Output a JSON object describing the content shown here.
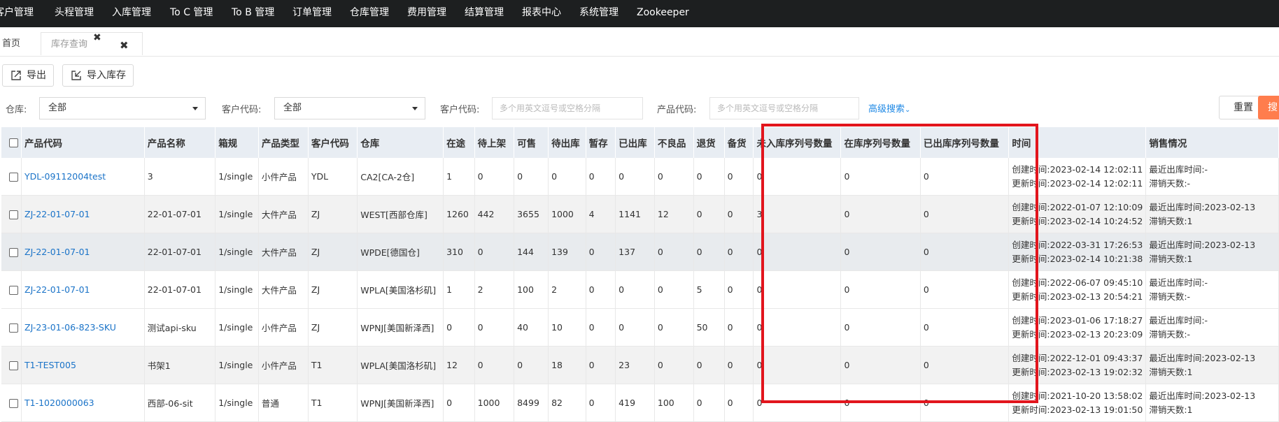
{
  "nav": [
    "客户管理",
    "头程管理",
    "入库管理",
    "To C 管理",
    "To B 管理",
    "订单管理",
    "仓库管理",
    "费用管理",
    "结算管理",
    "报表中心",
    "系统管理",
    "Zookeeper"
  ],
  "tabs": {
    "home": "首页",
    "stock": "库存查询"
  },
  "toolbar": {
    "export": "导出",
    "import": "导入库存"
  },
  "filters": {
    "warehouse_label": "仓库:",
    "warehouse_value": "全部",
    "customer_code_label": "客户代码:",
    "customer_code_value": "全部",
    "customer_code2_label": "客户代码:",
    "customer_code2_placeholder": "多个用英文逗号或空格分隔",
    "product_code_label": "产品代码:",
    "product_code_placeholder": "多个用英文逗号或空格分隔",
    "advanced": "高级搜索",
    "reset": "重置",
    "search": "搜"
  },
  "columns": [
    "产品代码",
    "产品名称",
    "箱规",
    "产品类型",
    "客户代码",
    "仓库",
    "在途",
    "待上架",
    "可售",
    "待出库",
    "暂存",
    "已出库",
    "不良品",
    "退货",
    "备货",
    "未入库序列号数量",
    "在库序列号数量",
    "已出库序列号数量",
    "时间",
    "销售情况"
  ],
  "time_labels": {
    "created": "创建时间:",
    "updated": "更新时间:"
  },
  "sales_labels": {
    "last_out": "最近出库时间:",
    "slow_days": "滞销天数:"
  },
  "rows": [
    {
      "code": "YDL-09112004test",
      "name": "3",
      "box": "1/single",
      "type": "小件产品",
      "cust": "YDL",
      "wh": "CA2[CA-2仓]",
      "c1": "1",
      "c2": "0",
      "c3": "0",
      "c4": "0",
      "c5": "0",
      "c6": "0",
      "c7": "0",
      "c8": "0",
      "c9": "0",
      "s1": "0",
      "s2": "0",
      "s3": "0",
      "created": "2023-02-14 12:02:11",
      "updated": "2023-02-14 12:02:11",
      "last_out": "-",
      "slow_days": "-"
    },
    {
      "code": "ZJ-22-01-07-01",
      "name": "22-01-07-01",
      "box": "1/single",
      "type": "大件产品",
      "cust": "ZJ",
      "wh": "WEST[西部仓库]",
      "c1": "1260",
      "c2": "442",
      "c3": "3655",
      "c4": "1000",
      "c5": "4",
      "c6": "1141",
      "c7": "12",
      "c8": "0",
      "c9": "0",
      "s1": "3",
      "s2": "0",
      "s3": "0",
      "created": "2022-01-07 12:10:09",
      "updated": "2023-02-14 10:24:52",
      "last_out": "2023-02-13",
      "slow_days": "1"
    },
    {
      "code": "ZJ-22-01-07-01",
      "name": "22-01-07-01",
      "box": "1/single",
      "type": "大件产品",
      "cust": "ZJ",
      "wh": "WPDE[德国仓]",
      "c1": "310",
      "c2": "0",
      "c3": "144",
      "c4": "139",
      "c5": "0",
      "c6": "137",
      "c7": "0",
      "c8": "0",
      "c9": "0",
      "s1": "0",
      "s2": "0",
      "s3": "0",
      "created": "2022-03-31 17:26:53",
      "updated": "2023-02-14 10:21:38",
      "last_out": "2023-02-13",
      "slow_days": "1"
    },
    {
      "code": "ZJ-22-01-07-01",
      "name": "22-01-07-01",
      "box": "1/single",
      "type": "大件产品",
      "cust": "ZJ",
      "wh": "WPLA[美国洛杉矶]",
      "c1": "1",
      "c2": "2",
      "c3": "100",
      "c4": "2",
      "c5": "0",
      "c6": "0",
      "c7": "0",
      "c8": "5",
      "c9": "0",
      "s1": "0",
      "s2": "0",
      "s3": "0",
      "created": "2022-06-07 09:45:10",
      "updated": "2023-02-13 20:54:21",
      "last_out": "-",
      "slow_days": "-"
    },
    {
      "code": "ZJ-23-01-06-823-SKU",
      "name": "测试api-sku",
      "box": "1/single",
      "type": "小件产品",
      "cust": "ZJ",
      "wh": "WPNJ[美国新泽西]",
      "c1": "0",
      "c2": "0",
      "c3": "40",
      "c4": "10",
      "c5": "0",
      "c6": "0",
      "c7": "0",
      "c8": "50",
      "c9": "0",
      "s1": "0",
      "s2": "0",
      "s3": "0",
      "created": "2023-01-06 17:18:27",
      "updated": "2023-02-13 20:23:09",
      "last_out": "-",
      "slow_days": "-"
    },
    {
      "code": "T1-TEST005",
      "name": "书架1",
      "box": "1/single",
      "type": "小件产品",
      "cust": "T1",
      "wh": "WPLA[美国洛杉矶]",
      "c1": "12",
      "c2": "0",
      "c3": "0",
      "c4": "18",
      "c5": "0",
      "c6": "23",
      "c7": "0",
      "c8": "0",
      "c9": "0",
      "s1": "0",
      "s2": "0",
      "s3": "0",
      "created": "2022-12-01 09:43:37",
      "updated": "2023-02-13 19:02:32",
      "last_out": "2023-02-13",
      "slow_days": "1"
    },
    {
      "code": "T1-1020000063",
      "name": "西部-06-sit",
      "box": "1/single",
      "type": "普通",
      "cust": "T1",
      "wh": "WPNJ[美国新泽西]",
      "c1": "0",
      "c2": "1000",
      "c3": "8499",
      "c4": "82",
      "c5": "0",
      "c6": "419",
      "c7": "100",
      "c8": "0",
      "c9": "0",
      "s1": "0",
      "s2": "0",
      "s3": "0",
      "created": "2021-10-20 13:58:02",
      "updated": "2023-02-13 19:01:50",
      "last_out": "2023-02-13",
      "slow_days": "1"
    }
  ],
  "colors": {
    "nav_bg": "#1d1f20",
    "link": "#1a73c8",
    "highlight_box": "#e2151d",
    "search_btn": "#ff7d4d"
  }
}
